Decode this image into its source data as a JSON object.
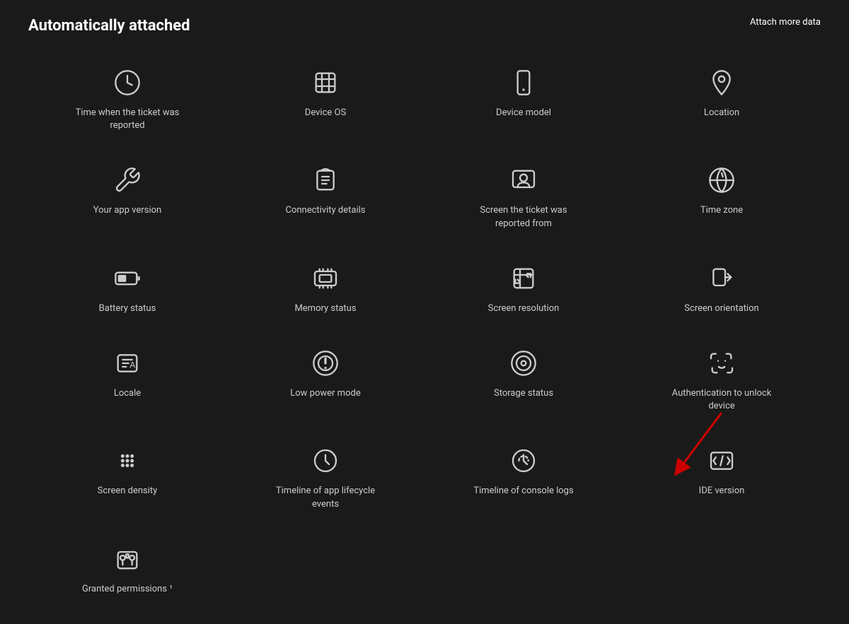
{
  "header": {
    "title": "Automatically attached",
    "attach_more_label": "Attach more data"
  },
  "items": [
    {
      "id": "time-reported",
      "label": "Time when the ticket was reported",
      "icon": "clock"
    },
    {
      "id": "device-os",
      "label": "Device OS",
      "icon": "hash"
    },
    {
      "id": "device-model",
      "label": "Device model",
      "icon": "smartphone"
    },
    {
      "id": "location",
      "label": "Location",
      "icon": "map-pin"
    },
    {
      "id": "app-version",
      "label": "Your app version",
      "icon": "wrench"
    },
    {
      "id": "connectivity",
      "label": "Connectivity details",
      "icon": "wifi"
    },
    {
      "id": "screen-from",
      "label": "Screen the ticket was reported from",
      "icon": "screen-user"
    },
    {
      "id": "time-zone",
      "label": "Time zone",
      "icon": "clock-globe"
    },
    {
      "id": "battery",
      "label": "Battery status",
      "icon": "battery"
    },
    {
      "id": "memory",
      "label": "Memory status",
      "icon": "memory"
    },
    {
      "id": "screen-resolution",
      "label": "Screen resolution",
      "icon": "screen-resize"
    },
    {
      "id": "screen-orientation",
      "label": "Screen orientation",
      "icon": "screen-rotate"
    },
    {
      "id": "locale",
      "label": "Locale",
      "icon": "locale"
    },
    {
      "id": "low-power",
      "label": "Low power mode",
      "icon": "low-power"
    },
    {
      "id": "storage",
      "label": "Storage status",
      "icon": "storage"
    },
    {
      "id": "auth-unlock",
      "label": "Authentication to unlock device",
      "icon": "face-id"
    },
    {
      "id": "screen-density",
      "label": "Screen density",
      "icon": "screen-density"
    },
    {
      "id": "lifecycle",
      "label": "Timeline of app lifecycle events",
      "icon": "lifecycle"
    },
    {
      "id": "console-logs",
      "label": "Timeline of console logs",
      "icon": "console"
    },
    {
      "id": "ide-version",
      "label": "IDE version",
      "icon": "ide"
    },
    {
      "id": "permissions",
      "label": "Granted permissions ¹",
      "icon": "permissions"
    }
  ]
}
